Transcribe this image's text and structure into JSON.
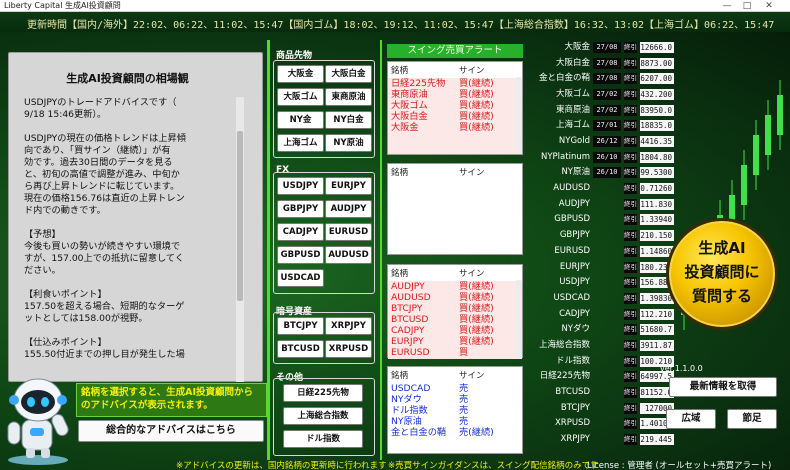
{
  "window": {
    "title": "Liberty Capital 生成AI投資顧問"
  },
  "update_bar": {
    "text": "更新時間【国内/海外】22:02、06:22、11:02、15:47【国内ゴム】18:02、19:12、11:02、15:47【上海総合指数】16:32、13:02【上海ゴム】06:22、15:47"
  },
  "advice": {
    "title": "生成AI投資顧問の相場観",
    "body": "USDJPYのトレードアドバイスです（\n9/18 15:46更新）。\n\nUSDJPYの現在の価格トレンドは上昇傾\n向であり、「買サイン（継続）」が有\n効です。過去30日間のデータを見る\nと、初旬の高値で調整が進み、中旬か\nら再び上昇トレンドに転じています。\n現在の価格156.76は直近の上昇トレン\nド内での動きです。\n\n【予想】\n今後も買いの勢いが続きやすい環境で\nすが、157.00上での抵抗に留意してく\nださい。\n\n【利食いポイント】\n157.50を超える場合、短期的なターゲ\nットとしては158.00が視野。\n\n【仕込みポイント】\n155.50付近までの押し目が発生した場"
  },
  "prompt": {
    "text": "銘柄を選択すると、生成AI投資顧問からのアドバイスが表示されます。"
  },
  "overall_button": "総合的なアドバイスはこちら",
  "sections": {
    "commodities": {
      "label": "商品先物",
      "buttons": [
        "大阪金",
        "大阪白金",
        "大阪ゴム",
        "東商原油",
        "NY金",
        "NY白金",
        "上海ゴム",
        "NY原油"
      ]
    },
    "fx": {
      "label": "FX",
      "buttons": [
        "USDJPY",
        "EURJPY",
        "GBPJPY",
        "AUDJPY",
        "CADJPY",
        "EURUSD",
        "GBPUSD",
        "AUDUSD",
        "USDCAD"
      ]
    },
    "crypto": {
      "label": "暗号資産",
      "buttons": [
        "BTCJPY",
        "XRPJPY",
        "BTCUSD",
        "XRPUSD"
      ]
    },
    "other": {
      "label": "その他",
      "buttons": [
        "日経225先物",
        "上海総合指数",
        "ドル指数"
      ]
    }
  },
  "swing": {
    "header": "スイング売買アラート",
    "col_name": "銘柄",
    "col_sign": "サイン",
    "table1": [
      {
        "name": "日経225先物",
        "sign": "買(継続)",
        "color": "red"
      },
      {
        "name": "東商原油",
        "sign": "買(継続)",
        "color": "red"
      },
      {
        "name": "大阪ゴム",
        "sign": "買(継続)",
        "color": "red"
      },
      {
        "name": "大阪白金",
        "sign": "買(継続)",
        "color": "red"
      },
      {
        "name": "大阪金",
        "sign": "買(継続)",
        "color": "red"
      }
    ],
    "table2": [],
    "table3": [
      {
        "name": "AUDJPY",
        "sign": "買(継続)",
        "color": "red"
      },
      {
        "name": "AUDUSD",
        "sign": "買(継続)",
        "color": "red"
      },
      {
        "name": "BTCJPY",
        "sign": "買(継続)",
        "color": "red"
      },
      {
        "name": "BTCUSD",
        "sign": "買(継続)",
        "color": "red"
      },
      {
        "name": "CADJPY",
        "sign": "買(継続)",
        "color": "red"
      },
      {
        "name": "EURJPY",
        "sign": "買(継続)",
        "color": "red"
      },
      {
        "name": "EURUSD",
        "sign": "買",
        "color": "red"
      }
    ],
    "table4": [
      {
        "name": "USDCAD",
        "sign": "売",
        "color": "blue"
      },
      {
        "name": "NYダウ",
        "sign": "売",
        "color": "blue"
      },
      {
        "name": "ドル指数",
        "sign": "売",
        "color": "blue"
      },
      {
        "name": "NY原油",
        "sign": "売",
        "color": "blue"
      },
      {
        "name": "金と白金の鞘",
        "sign": "売(継続)",
        "color": "blue"
      }
    ]
  },
  "market": [
    {
      "name": "大阪金",
      "date": "27/08",
      "label": "終引",
      "value": "12666.0"
    },
    {
      "name": "大阪白金",
      "date": "27/08",
      "label": "終引",
      "value": "8873.00"
    },
    {
      "name": "金と白金の鞘",
      "date": "27/08",
      "label": "終引",
      "value": "6207.00"
    },
    {
      "name": "大阪ゴム",
      "date": "27/02",
      "label": "終引",
      "value": "432.200"
    },
    {
      "name": "東商原油",
      "date": "27/02",
      "label": "終引",
      "value": "83950.0"
    },
    {
      "name": "上海ゴム",
      "date": "27/01",
      "label": "終引",
      "value": "18835.0"
    },
    {
      "name": "NYGold",
      "date": "26/12",
      "label": "終引",
      "value": "4416.35"
    },
    {
      "name": "NYPlatinum",
      "date": "26/10",
      "label": "終引",
      "value": "1804.80"
    },
    {
      "name": "NY原油",
      "date": "26/10",
      "label": "終引",
      "value": "99.5300"
    },
    {
      "name": "AUDUSD",
      "date": "",
      "label": "終引",
      "value": "0.71260"
    },
    {
      "name": "AUDJPY",
      "date": "",
      "label": "終引",
      "value": "111.830"
    },
    {
      "name": "GBPUSD",
      "date": "",
      "label": "終引",
      "value": "1.33940"
    },
    {
      "name": "GBPJPY",
      "date": "",
      "label": "終引",
      "value": "210.150"
    },
    {
      "name": "EURUSD",
      "date": "",
      "label": "終引",
      "value": "1.14860"
    },
    {
      "name": "EURJPY",
      "date": "",
      "label": "終引",
      "value": "180.230"
    },
    {
      "name": "USDJPY",
      "date": "",
      "label": "終引",
      "value": "156.880"
    },
    {
      "name": "USDCAD",
      "date": "",
      "label": "終引",
      "value": "1.39830"
    },
    {
      "name": "CADJPY",
      "date": "",
      "label": "終引",
      "value": "112.210"
    },
    {
      "name": "NYダウ",
      "date": "",
      "label": "終引",
      "value": "51680.7"
    },
    {
      "name": "上海総合指数",
      "date": "",
      "label": "終引",
      "value": "3911.87"
    },
    {
      "name": "ドル指数",
      "date": "",
      "label": "終引",
      "value": "100.210"
    },
    {
      "name": "日経225先物",
      "date": "",
      "label": "終引",
      "value": "64997.5"
    },
    {
      "name": "BTCUSD",
      "date": "",
      "label": "終引",
      "value": "81152.0"
    },
    {
      "name": "BTCJPY",
      "date": "",
      "label": "終引",
      "value": "127000"
    },
    {
      "name": "XRPUSD",
      "date": "",
      "label": "終引",
      "value": "1.40100"
    },
    {
      "name": "XRPJPY",
      "date": "",
      "label": "終引",
      "value": "219.445"
    }
  ],
  "ask": {
    "line1": "生成AI",
    "line2": "投資顧問に",
    "line3": "質問する"
  },
  "version": "ver.1.1.0.0",
  "latest_button": "最新情報を取得",
  "wide_button": "広域",
  "settings_button": "節足",
  "footer": {
    "note1": "※アドバイスの更新は、国内銘柄の更新時に行われます",
    "note2": "※売買サインガイダンスは、スイング配信銘柄のみです",
    "license": "License : 管理者 (オールセット+売買アラート)"
  }
}
